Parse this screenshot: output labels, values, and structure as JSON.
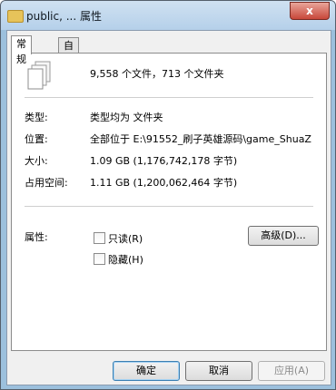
{
  "window": {
    "title": "public, ... 属性",
    "close_glyph": "x"
  },
  "tabs": [
    {
      "label": "常规",
      "active": true
    },
    {
      "label": "自定义",
      "active": false
    }
  ],
  "summary": {
    "icon": "stacked-files-icon",
    "text": "9,558 个文件，713 个文件夹"
  },
  "properties": {
    "type_label": "类型:",
    "type_value": "类型均为 文件夹",
    "location_label": "位置:",
    "location_value": "全部位于 E:\\91552_刷子英雄源码\\game_ShuaZ",
    "size_label": "大小:",
    "size_value": "1.09 GB (1,176,742,178 字节)",
    "disk_label": "占用空间:",
    "disk_value": "1.11 GB (1,200,062,464 字节)"
  },
  "attributes": {
    "label": "属性:",
    "readonly_label": "只读(R)",
    "hidden_label": "隐藏(H)",
    "advanced_label": "高级(D)..."
  },
  "buttons": {
    "ok": "确定",
    "cancel": "取消",
    "apply": "应用(A)"
  }
}
